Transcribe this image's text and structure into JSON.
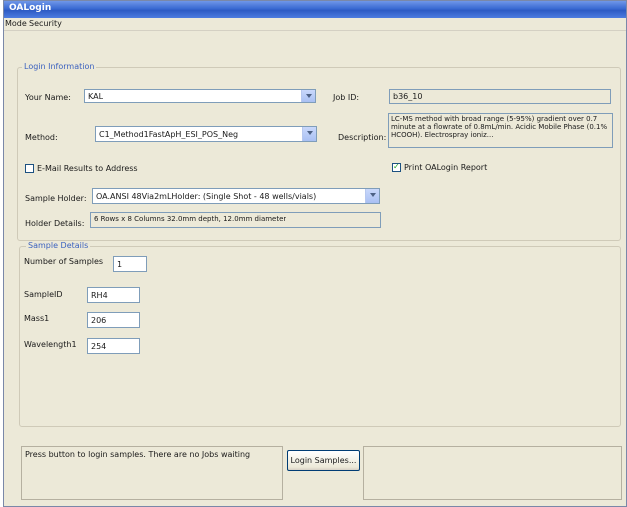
{
  "window": {
    "title": "OALogin"
  },
  "menu": [
    "Mode",
    "Security"
  ],
  "login_info": {
    "group_title": "Login Information",
    "your_name_label": "Your Name:",
    "your_name_value": "KAL",
    "job_id_label": "Job ID:",
    "job_id_value": "b36_10",
    "method_label": "Method:",
    "method_value": "C1_Method1FastApH_ESI_POS_Neg",
    "description_label": "Description:",
    "description_value": "LC-MS method with broad range (5-95%) gradient over 0.7 minute at a flowrate of 0.8mL/min. Acidic Mobile Phase (0.1% HCOOH). Electrospray ioniz...",
    "email_label": "E-Mail Results to Address",
    "email_checked": false,
    "print_label": "Print OALogin Report",
    "print_checked": true,
    "sample_holder_label": "Sample Holder:",
    "sample_holder_value": "OA.ANSI 48Via2mLHolder: (Single Shot - 48 wells/vials)",
    "holder_details_label": "Holder Details:",
    "holder_details_value": "6 Rows x 8 Columns      32.0mm depth, 12.0mm diameter"
  },
  "sample_details": {
    "group_title": "Sample Details",
    "num_samples_label": "Number of Samples",
    "num_samples_value": "1",
    "fields": [
      {
        "label": "SampleID",
        "value": "RH4"
      },
      {
        "label": "Mass1",
        "value": "206"
      },
      {
        "label": "Wavelength1",
        "value": "254"
      }
    ]
  },
  "status": {
    "message": "Press button to login samples. There are no Jobs waiting",
    "login_button": "Login Samples..."
  }
}
